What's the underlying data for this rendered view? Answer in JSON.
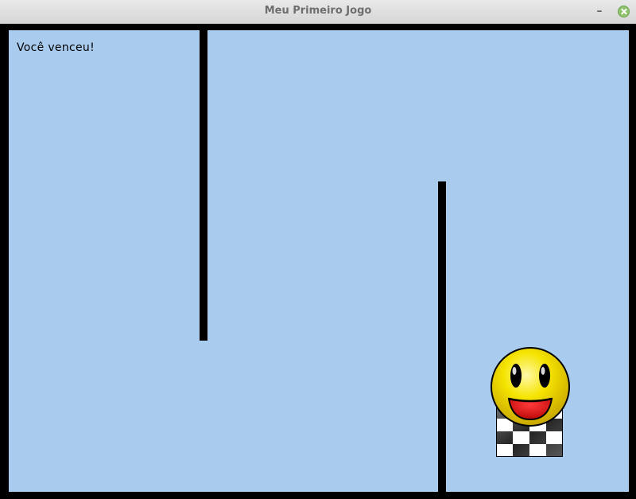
{
  "window": {
    "title": "Meu Primeiro Jogo",
    "minimize_glyph": "–",
    "close_icon": "close-icon"
  },
  "game": {
    "status_text": "Você venceu!",
    "background_color": "#a9cbee",
    "wall_color": "#000000",
    "player_icon": "smiley-face-icon",
    "goal_icon": "checkered-flag-icon"
  }
}
